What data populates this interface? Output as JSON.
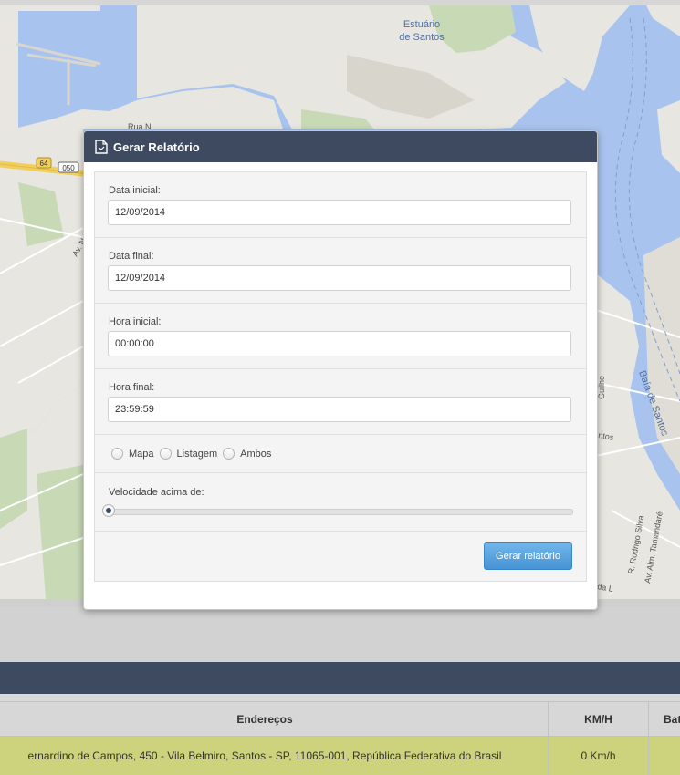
{
  "map": {
    "labels": {
      "estuary_line1": "Estuário",
      "estuary_line2": "de Santos",
      "bay": "Baía de Santos",
      "street_rua": "Rua N",
      "street_av_n": "Av. N",
      "road_64": "64",
      "road_050": "050",
      "street_rodrigo_silva": "R. Rodrigo Silva",
      "street_alm_tamandare": "Av. Alm. Tamandaré",
      "street_guilhe": "Guilhe",
      "street_ntos": "ntos",
      "street_tamandare": "Tamandaré",
      "street_dal": "da L"
    },
    "colors": {
      "water": "#a8c4ee",
      "land": "#e8e6e0",
      "park": "#c8d9b6",
      "highway": "#f2cf5a"
    }
  },
  "modal": {
    "title": "Gerar Relatório",
    "icon": "document-icon",
    "fields": {
      "data_inicial": {
        "label": "Data inicial:",
        "value": "12/09/2014"
      },
      "data_final": {
        "label": "Data final:",
        "value": "12/09/2014"
      },
      "hora_inicial": {
        "label": "Hora inicial:",
        "value": "00:00:00"
      },
      "hora_final": {
        "label": "Hora final:",
        "value": "23:59:59"
      }
    },
    "radio_options": [
      "Mapa",
      "Listagem",
      "Ambos"
    ],
    "speed": {
      "label": "Velocidade acima de:",
      "value": 0
    },
    "submit_label": "Gerar relatório",
    "colors": {
      "header": "#3d4a5f",
      "button": "#5aa5e0"
    }
  },
  "table": {
    "headers": {
      "address": "Endereços",
      "speed": "KM/H",
      "battery": "Bat"
    },
    "rows": [
      {
        "address": "ernardino de Campos, 450 - Vila Belmiro, Santos - SP, 11065-001, República Federativa do Brasil",
        "speed": "0 Km/h",
        "battery": ""
      }
    ],
    "row_color": "#cdd37c"
  }
}
